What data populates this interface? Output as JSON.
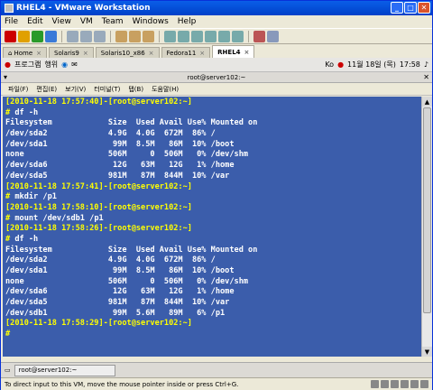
{
  "window": {
    "title": "RHEL4 - VMware Workstation"
  },
  "menu": [
    "File",
    "Edit",
    "View",
    "VM",
    "Team",
    "Windows",
    "Help"
  ],
  "tabs": [
    {
      "label": "Home"
    },
    {
      "label": "Solaris9"
    },
    {
      "label": "Solaris10_x86"
    },
    {
      "label": "Fedora11"
    },
    {
      "label": "RHEL4",
      "active": true
    }
  ],
  "guest_panel": {
    "apps": "프로그램",
    "actions": "행위",
    "kbd": "Ko",
    "date": "11월 18일 (목)",
    "time": "17:58"
  },
  "terminal": {
    "title": "root@server102:~",
    "menu": [
      "파일(F)",
      "편집(E)",
      "보기(V)",
      "터미널(T)",
      "탭(B)",
      "도움말(H)"
    ],
    "lines": [
      {
        "p": "[2010-11-18 17:57:40]-[root@server102:~]",
        "c": ""
      },
      {
        "p": "# ",
        "c": "df -h"
      },
      {
        "p": "",
        "c": "Filesystem            Size  Used Avail Use% Mounted on"
      },
      {
        "p": "",
        "c": "/dev/sda2             4.9G  4.0G  672M  86% /"
      },
      {
        "p": "",
        "c": "/dev/sda1              99M  8.5M   86M  10% /boot"
      },
      {
        "p": "",
        "c": "none                  506M     0  506M   0% /dev/shm"
      },
      {
        "p": "",
        "c": "/dev/sda6              12G   63M   12G   1% /home"
      },
      {
        "p": "",
        "c": "/dev/sda5             981M   87M  844M  10% /var"
      },
      {
        "p": "[2010-11-18 17:57:41]-[root@server102:~]",
        "c": ""
      },
      {
        "p": "# ",
        "c": "mkdir /p1"
      },
      {
        "p": "[2010-11-18 17:58:10]-[root@server102:~]",
        "c": ""
      },
      {
        "p": "# ",
        "c": "mount /dev/sdb1 /p1"
      },
      {
        "p": "[2010-11-18 17:58:26]-[root@server102:~]",
        "c": ""
      },
      {
        "p": "# ",
        "c": "df -h"
      },
      {
        "p": "",
        "c": "Filesystem            Size  Used Avail Use% Mounted on"
      },
      {
        "p": "",
        "c": "/dev/sda2             4.9G  4.0G  672M  86% /"
      },
      {
        "p": "",
        "c": "/dev/sda1              99M  8.5M   86M  10% /boot"
      },
      {
        "p": "",
        "c": "none                  506M     0  506M   0% /dev/shm"
      },
      {
        "p": "",
        "c": "/dev/sda6              12G   63M   12G   1% /home"
      },
      {
        "p": "",
        "c": "/dev/sda5             981M   87M  844M  10% /var"
      },
      {
        "p": "",
        "c": "/dev/sdb1              99M  5.6M   89M   6% /p1"
      },
      {
        "p": "[2010-11-18 17:58:29]-[root@server102:~]",
        "c": ""
      },
      {
        "p": "#",
        "c": ""
      }
    ]
  },
  "taskbar": {
    "item": "root@server102:~"
  },
  "status": {
    "text": "To direct input to this VM, move the mouse pointer inside or press Ctrl+G."
  }
}
